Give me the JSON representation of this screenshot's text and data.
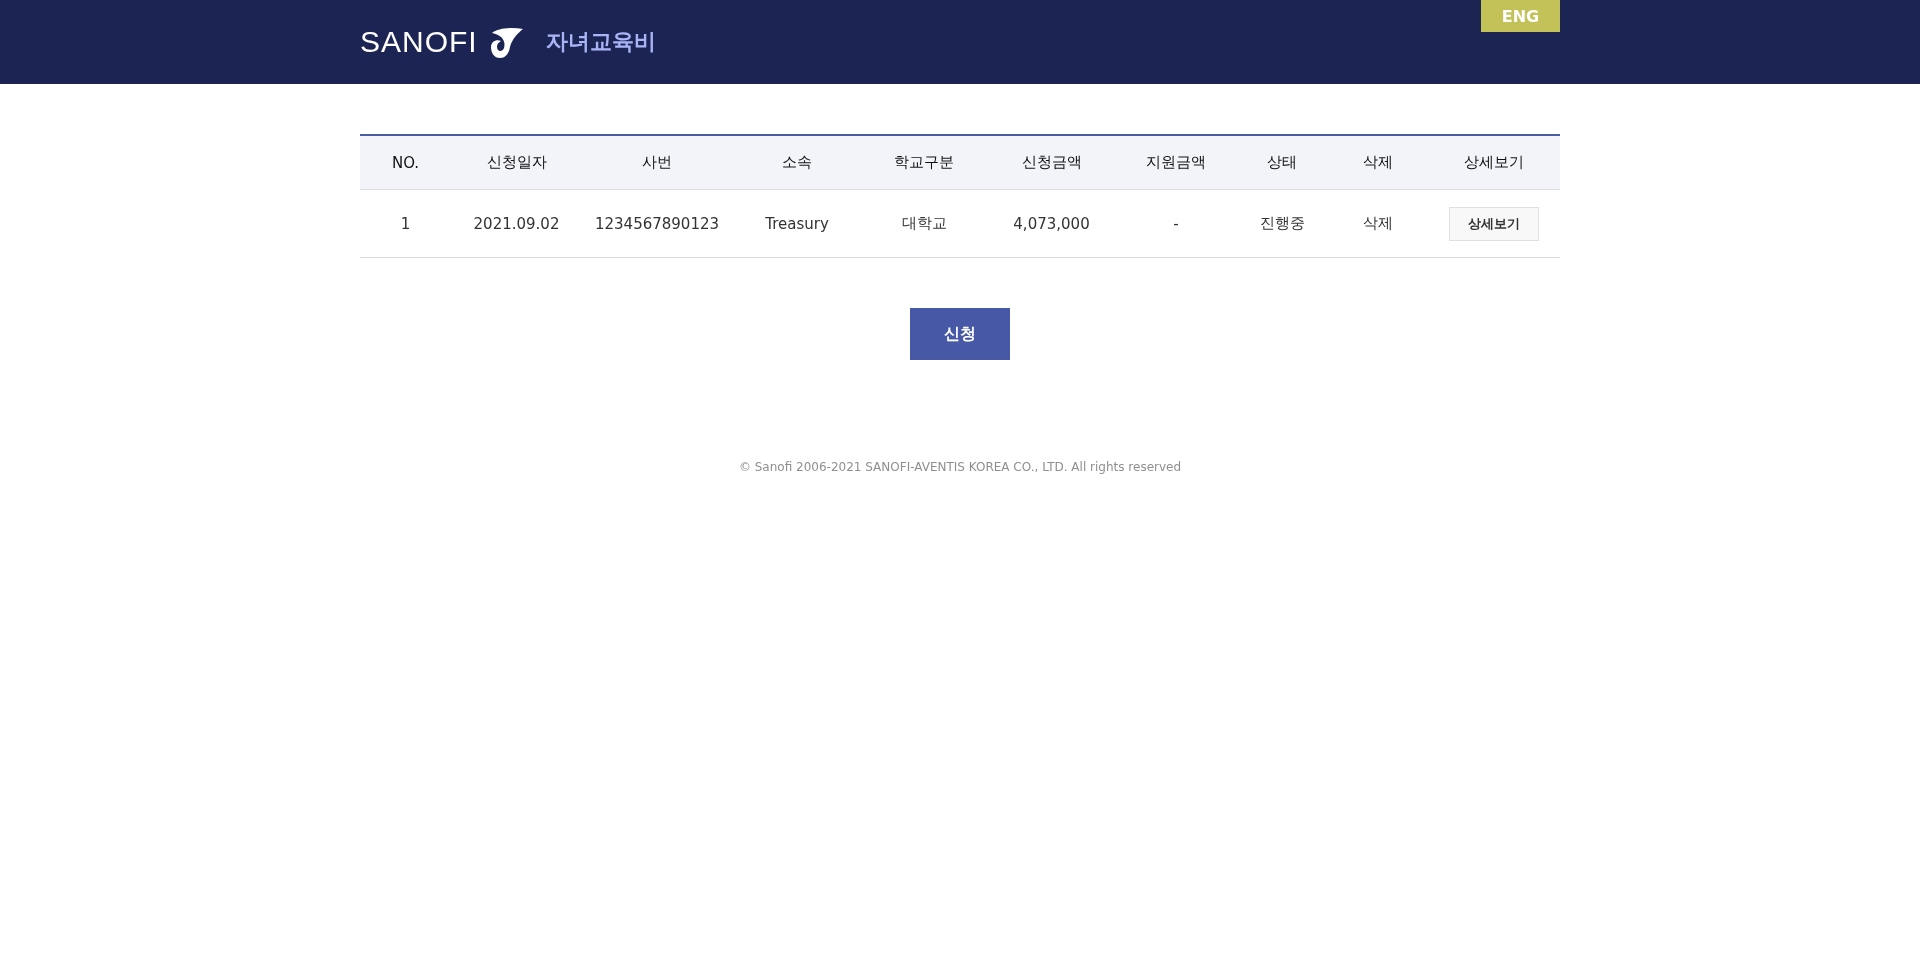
{
  "header": {
    "logo_text": "SANOFI",
    "title": "자녀교육비",
    "language_button": "ENG"
  },
  "table": {
    "columns": [
      "NO.",
      "신청일자",
      "사번",
      "소속",
      "학교구분",
      "신청금액",
      "지원금액",
      "상태",
      "삭제",
      "상세보기"
    ],
    "rows": [
      {
        "cells": [
          "1",
          "2021.09.02",
          "1234567890123",
          "Treasury",
          "대학교",
          "4,073,000",
          "-",
          "진행중",
          "삭제"
        ],
        "detail_button": "상세보기"
      }
    ]
  },
  "apply_button": "신청",
  "footer": "© Sanofi 2006-2021 SANOFI-AVENTIS KOREA CO., LTD. All rights reserved"
}
